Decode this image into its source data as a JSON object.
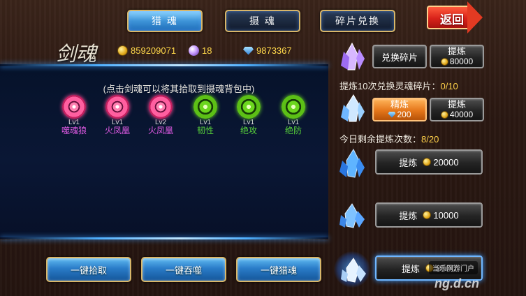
{
  "tabs": [
    {
      "label": "猎 魂",
      "active": true
    },
    {
      "label": "摄 魂",
      "active": false
    },
    {
      "label": "碎片兑换",
      "active": false
    }
  ],
  "back_label": "返回",
  "title": "剑魂",
  "currencies": {
    "coins": "859209071",
    "orbs": "18",
    "gems": "9873367"
  },
  "hint": "(点击剑魂可以将其拾取到摄魂背包中)",
  "souls": [
    {
      "level": "Lv1",
      "name": "噬魂狼",
      "color": "pink"
    },
    {
      "level": "Lv1",
      "name": "火凤凰",
      "color": "pink"
    },
    {
      "level": "Lv2",
      "name": "火凤凰",
      "color": "pink"
    },
    {
      "level": "Lv1",
      "name": "韧性",
      "color": "green"
    },
    {
      "level": "Lv1",
      "name": "绝攻",
      "color": "green"
    },
    {
      "level": "Lv1",
      "name": "绝防",
      "color": "green"
    }
  ],
  "bottom_buttons": {
    "pick_all": "一键拾取",
    "devour_all": "一键吞噬",
    "hunt_all": "一键猎魂"
  },
  "right": {
    "exchange_fragment": "兑换碎片",
    "refine_label": "提炼",
    "row1_cost": "80000",
    "exchange_info_label": "提炼10次兑换灵魂碎片：",
    "exchange_info_value": "0/10",
    "fine_label": "精炼",
    "row2_gem_cost": "200",
    "row2_cost": "40000",
    "remaining_label": "今日剩余提炼次数：",
    "remaining_value": "8/20",
    "row3_cost": "20000",
    "row4_cost": "10000",
    "row5_cost": "8000"
  },
  "watermark": {
    "line1": "当乐网游门户",
    "line2": "ng.d.cn"
  },
  "colors": {
    "accent_gold": "#ffd24a",
    "tab_active": "#3e94d8",
    "back_red": "#d8221a",
    "panel_glow": "#4fb0ff"
  }
}
